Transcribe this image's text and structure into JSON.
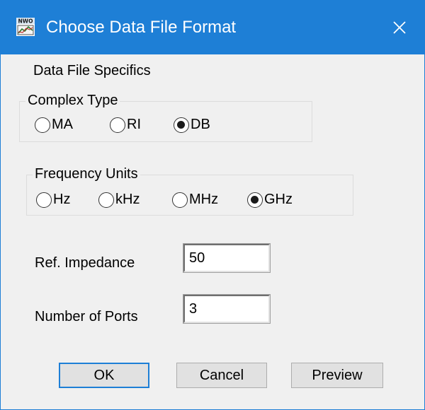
{
  "window": {
    "title": "Choose Data File Format",
    "close_glyph": "✕",
    "title_color": "#1e7fd6",
    "app_icon": "nwo-app-icon",
    "app_icon_text": "NWO"
  },
  "section_label": "Data File Specifics",
  "complex_type": {
    "title": "Complex Type",
    "options": [
      "MA",
      "RI",
      "DB"
    ],
    "selected": "DB"
  },
  "frequency_units": {
    "title": "Frequency Units",
    "options": [
      "Hz",
      "kHz",
      "MHz",
      "GHz"
    ],
    "selected": "GHz"
  },
  "ref_impedance": {
    "label": "Ref. Impedance",
    "value": "50"
  },
  "num_ports": {
    "label": "Number of Ports",
    "value": "3"
  },
  "buttons": {
    "ok": "OK",
    "cancel": "Cancel",
    "preview": "Preview"
  }
}
